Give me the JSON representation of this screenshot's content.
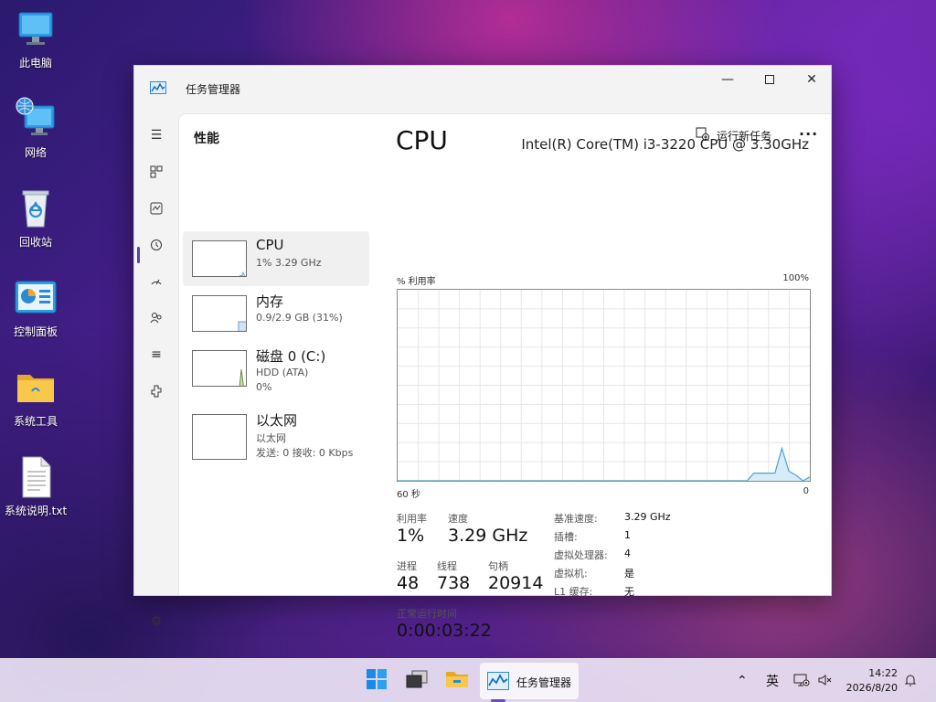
{
  "desktop": {
    "icons": [
      {
        "label": "此电脑",
        "icon": "computer-icon"
      },
      {
        "label": "网络",
        "icon": "network-icon"
      },
      {
        "label": "回收站",
        "icon": "recycle-bin-icon"
      },
      {
        "label": "控制面板",
        "icon": "control-panel-icon"
      },
      {
        "label": "系统工具",
        "icon": "folder-icon"
      },
      {
        "label": "系统说明.txt",
        "icon": "text-file-icon"
      }
    ]
  },
  "window": {
    "title": "任务管理器",
    "page_title": "性能",
    "run_new_task": "运行新任务",
    "more": "···"
  },
  "sidebar": {
    "items": [
      {
        "name": "CPU",
        "line1": "1% 3.29 GHz",
        "line2": ""
      },
      {
        "name": "内存",
        "line1": "0.9/2.9 GB (31%)",
        "line2": ""
      },
      {
        "name": "磁盘 0 (C:)",
        "line1": "HDD (ATA)",
        "line2": "0%"
      },
      {
        "name": "以太网",
        "line1": "以太网",
        "line2": "发送: 0 接收: 0 Kbps"
      }
    ]
  },
  "detail": {
    "heading": "CPU",
    "model": "Intel(R) Core(TM) i3-3220 CPU @ 3.30GHz",
    "y_label": "% 利用率",
    "y_max": "100%",
    "x_left": "60 秒",
    "x_right": "0",
    "stats": {
      "util_label": "利用率",
      "util_value": "1%",
      "speed_label": "速度",
      "speed_value": "3.29 GHz",
      "proc_label": "进程",
      "proc_value": "48",
      "threads_label": "线程",
      "threads_value": "738",
      "handles_label": "句柄",
      "handles_value": "20914",
      "uptime_label": "正常运行时间",
      "uptime_value": "0:00:03:22"
    },
    "specs": [
      {
        "key": "基准速度:",
        "value": "3.29 GHz"
      },
      {
        "key": "插槽:",
        "value": "1"
      },
      {
        "key": "虚拟处理器:",
        "value": "4"
      },
      {
        "key": "虚拟机:",
        "value": "是"
      },
      {
        "key": "L1 缓存:",
        "value": "无"
      }
    ],
    "cpu_history_percent": [
      0,
      0,
      0,
      0,
      0,
      0,
      0,
      0,
      0,
      0,
      0,
      0,
      0,
      0,
      0,
      0,
      0,
      0,
      0,
      0,
      0,
      0,
      0,
      0,
      0,
      0,
      0,
      0,
      0,
      0,
      0,
      0,
      0,
      0,
      0,
      0,
      0,
      0,
      0,
      0,
      0,
      0,
      0,
      0,
      0,
      0,
      0,
      0,
      0,
      0,
      0,
      4,
      4,
      4,
      4,
      17,
      5,
      3,
      0,
      2
    ]
  },
  "taskbar": {
    "running_label": "任务管理器",
    "ime": "英",
    "time": "14:22",
    "date": "2026/8/20"
  },
  "colors": {
    "accent": "#5b3fb0",
    "graph_line": "#4aa3d6",
    "graph_fill": "#d7ebf8",
    "disk_graph": "#4a7a1a"
  }
}
